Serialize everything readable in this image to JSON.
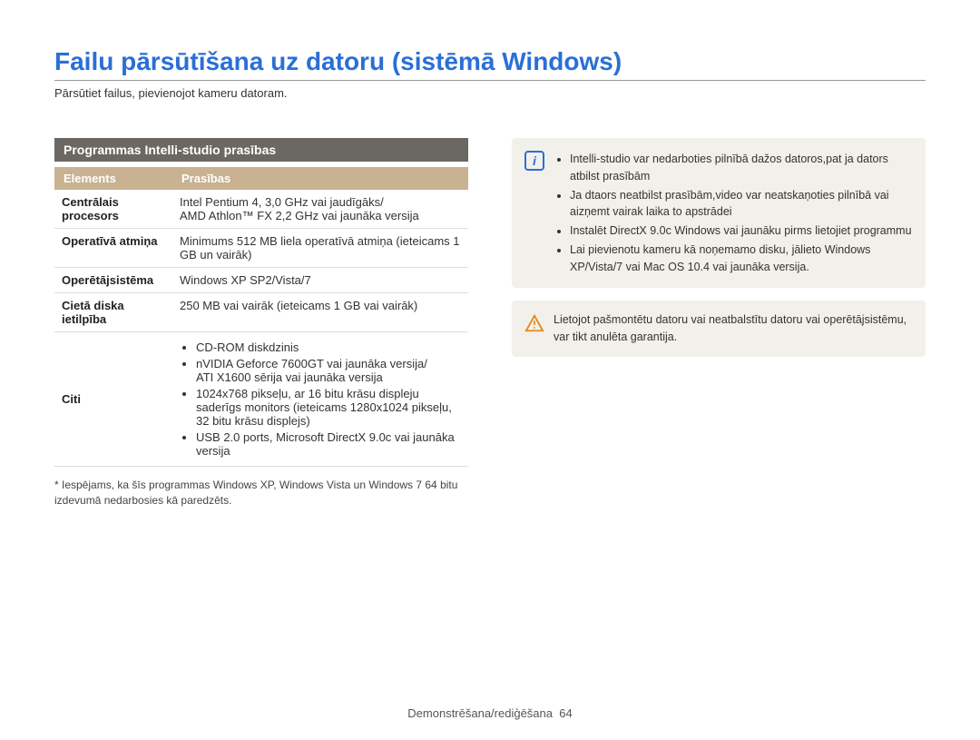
{
  "title": "Failu pārsūtīšana uz datoru (sistēmā Windows)",
  "subtitle": "Pārsūtiet failus, pievienojot kameru datoram.",
  "section_heading": "Programmas Intelli-studio prasības",
  "table": {
    "head_element": "Elements",
    "head_req": "Prasības",
    "rows": {
      "cpu": {
        "k": "Centrālais procesors",
        "v": "Intel Pentium 4, 3,0 GHz vai jaudīgāks/\nAMD Athlon™ FX 2,2 GHz vai jaunāka versija"
      },
      "ram": {
        "k": "Operatīvā atmiņa",
        "v": "Minimums 512 MB liela operatīvā atmiņa (ieteicams 1 GB un vairāk)"
      },
      "os": {
        "k": "Operētājsistēma",
        "v": "Windows XP SP2/Vista/7"
      },
      "hdd": {
        "k": "Cietā diska ietilpība",
        "v": "250 MB vai vairāk (ieteicams 1 GB vai vairāk)"
      },
      "other": {
        "k": "Citi",
        "items": [
          "CD-ROM diskdzinis",
          "nVIDIA Geforce 7600GT vai jaunāka versija/\nATI X1600 sērija vai jaunāka versija",
          "1024x768 pikseļu, ar 16 bitu krāsu displeju saderīgs monitors (ieteicams 1280x1024 pikseļu, 32 bitu krāsu displejs)",
          "USB 2.0 ports, Microsoft DirectX 9.0c vai jaunāka versija"
        ]
      }
    }
  },
  "footnote": "* Iespējams, ka šīs programmas Windows XP, Windows Vista un Windows 7 64 bitu izdevumā nedarbosies kā paredzēts.",
  "info_callout": {
    "items": [
      "Intelli-studio var nedarboties pilnībā dažos datoros,pat ja dators atbilst prasībām",
      "Ja dtaors neatbilst prasībām,video var neatskaņoties pilnībā vai aizņemt vairak laika to apstrādei",
      "Instalēt DirectX 9.0c Windows vai jaunāku pirms lietojiet programmu",
      "Lai pievienotu kameru kā noņemamo disku, jālieto Windows XP/Vista/7 vai Mac OS 10.4 vai jaunāka versija."
    ]
  },
  "warn_callout": {
    "text": "Lietojot pašmontētu datoru vai neatbalstītu datoru vai operētājsistēmu, var tikt anulēta garantija."
  },
  "footer": {
    "section": "Demonstrēšana/rediģēšana",
    "page": "64"
  }
}
